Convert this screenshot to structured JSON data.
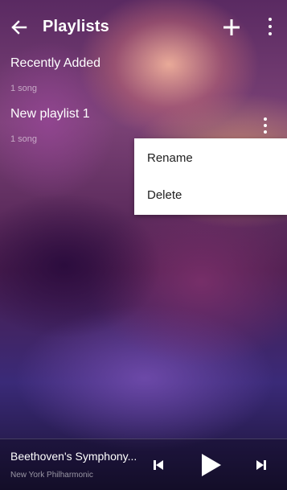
{
  "toolbar": {
    "title": "Playlists",
    "back_icon": "arrow-left-icon",
    "add_icon": "plus-icon",
    "menu_icon": "more-vert-icon"
  },
  "playlists": [
    {
      "name": "Recently Added",
      "count": "1 song"
    },
    {
      "name": "New playlist 1",
      "count": "1 song"
    }
  ],
  "context_menu": {
    "items": [
      "Rename",
      "Delete"
    ]
  },
  "now_playing": {
    "title": "Beethoven's Symphony...",
    "artist": "New York Philharmonic",
    "prev_icon": "skip-previous-icon",
    "play_icon": "play-icon",
    "next_icon": "skip-next-icon"
  },
  "colors": {
    "text_primary": "#ffffff",
    "menu_background": "#ffffff",
    "menu_text": "#212121"
  }
}
